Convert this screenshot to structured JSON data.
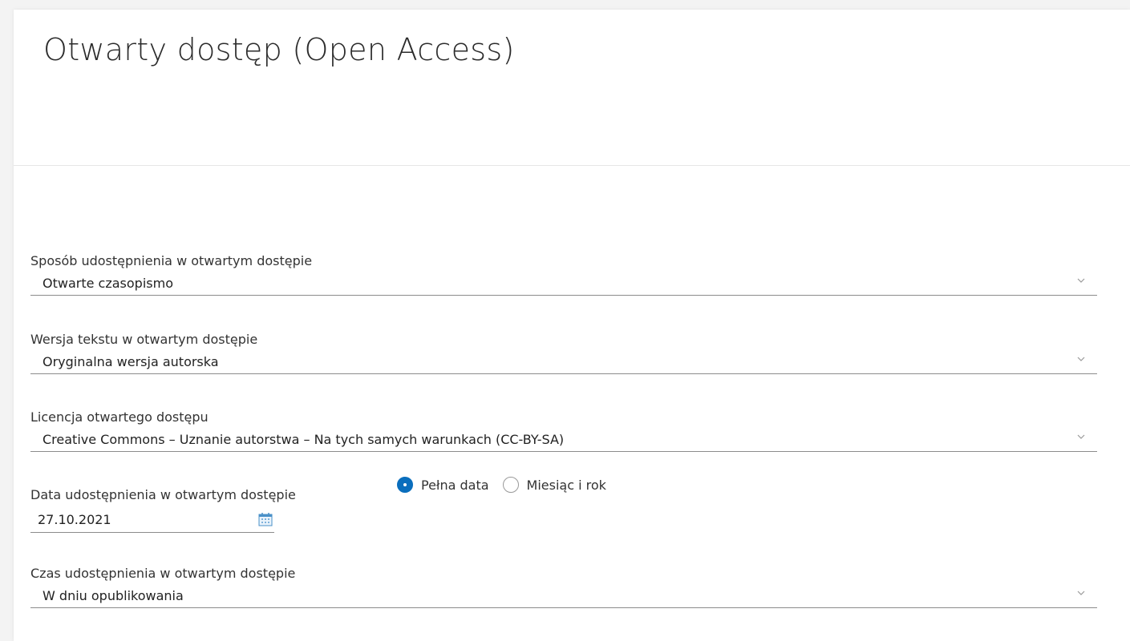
{
  "page": {
    "title": "Otwarty dostęp (Open Access)"
  },
  "fields": {
    "sharing_method": {
      "label": "Sposób udostępnienia w otwartym dostępie",
      "value": "Otwarte czasopismo"
    },
    "text_version": {
      "label": "Wersja tekstu w otwartym dostępie",
      "value": "Oryginalna wersja autorska"
    },
    "license": {
      "label": "Licencja otwartego dostępu",
      "value": "Creative Commons – Uznanie autorstwa – Na tych samych warunkach (CC-BY-SA)"
    },
    "date": {
      "label": "Data udostępnienia w otwartym dostępie",
      "value": "27.10.2021",
      "options": [
        {
          "label": "Pełna data",
          "selected": true
        },
        {
          "label": "Miesiąc i rok",
          "selected": false
        }
      ]
    },
    "timing": {
      "label": "Czas udostępnienia w otwartym dostępie",
      "value": "W dniu opublikowania"
    }
  },
  "colors": {
    "accent": "#0a6ebd",
    "underline": "#8c8c8c",
    "background": "#f3f3f3"
  },
  "icons": {
    "dropdown": "chevron-down-icon",
    "calendar": "calendar-icon"
  }
}
